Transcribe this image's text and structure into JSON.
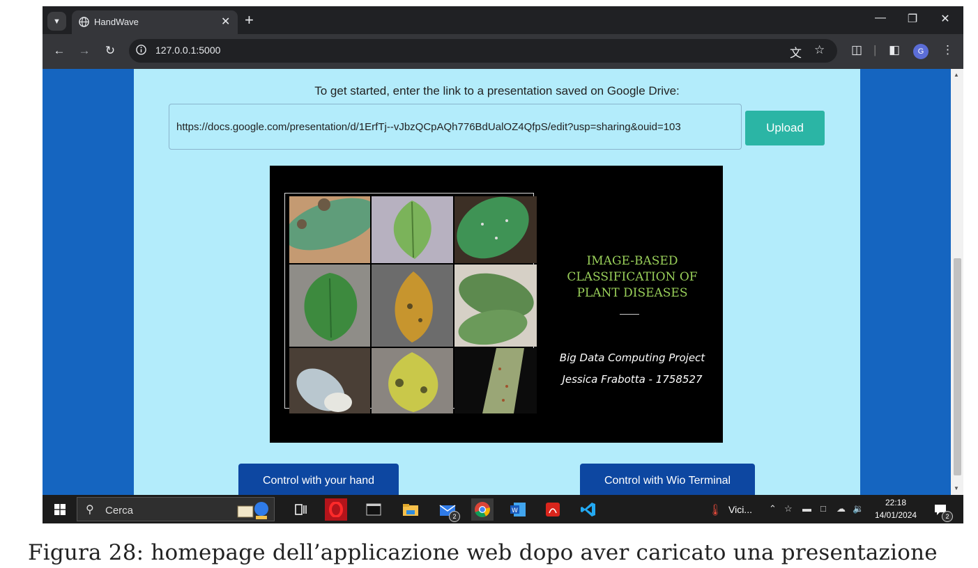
{
  "browser": {
    "tab_title": "HandWave",
    "url": "127.0.0.1:5000"
  },
  "page": {
    "prompt": "To get started, enter the link to a presentation saved on Google Drive:",
    "link_value": "https://docs.google.com/presentation/d/1ErfTj--vJbzQCpAQh776BdUalOZ4QfpS/edit?usp=sharing&ouid=103",
    "upload_label": "Upload",
    "slide": {
      "title_lines": [
        "IMAGE-BASED",
        "CLASSIFICATION OF",
        "PLANT DISEASES"
      ],
      "subtitle": "Big Data Computing Project",
      "author": "Jessica Frabotta - 1758527"
    },
    "control_hand_label": "Control with your hand",
    "control_wio_label": "Control with Wio Terminal"
  },
  "taskbar": {
    "search_placeholder": "Cerca",
    "weather_text": "Vici...",
    "time": "22:18",
    "date": "14/01/2024",
    "mail_badge": "2",
    "notification_badge": "2"
  },
  "caption": "Figura 28: homepage dell’applicazione web dopo aver caricato una presentazione"
}
